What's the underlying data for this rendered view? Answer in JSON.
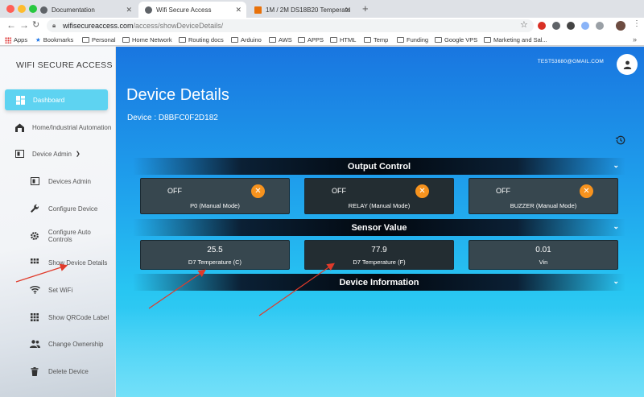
{
  "browser": {
    "tabs": [
      {
        "title": "Documentation",
        "favicon_color": "#5f6368"
      },
      {
        "title": "Wifi Secure Access",
        "favicon_color": "#5f6368"
      },
      {
        "title": "1M / 2M DS18B20 Temperatu",
        "favicon_color": "#e8710a"
      }
    ],
    "new_tab": "+",
    "url_host": "wifisecureaccess.com",
    "url_path": "/access/showDeviceDetails/",
    "bookmarks": [
      "Apps",
      "Bookmarks",
      "Personal",
      "Home Network",
      "Routing docs",
      "Arduino",
      "AWS",
      "APPS",
      "HTML",
      "Temp",
      "Funding",
      "Google VPS",
      "Marketing and Sal..."
    ]
  },
  "sidebar": {
    "brand": "WIFI SECURE ACCESS",
    "items": [
      {
        "label": "Dashboard",
        "icon": "dashboard-icon"
      },
      {
        "label": "Home/Industrial Automation",
        "icon": "home-icon"
      },
      {
        "label": "Device Admin",
        "icon": "device-admin-icon"
      },
      {
        "label": "Devices Admin",
        "icon": "devices-admin-icon"
      },
      {
        "label": "Configure Device",
        "icon": "wrench-icon"
      },
      {
        "label": "Configure Auto Controls",
        "icon": "gear-icon"
      },
      {
        "label": "Show Device Details",
        "icon": "grid-icon"
      },
      {
        "label": "Set WiFi",
        "icon": "wifi-icon"
      },
      {
        "label": "Show QRCode Label",
        "icon": "qrcode-icon"
      },
      {
        "label": "Change Ownership",
        "icon": "people-icon"
      },
      {
        "label": "Delete Device",
        "icon": "trash-icon"
      }
    ]
  },
  "header": {
    "user_email": "TEST53680@GMAIL.COM"
  },
  "main": {
    "title": "Device Details",
    "device_id": "Device : D8BFC0F2D182",
    "output_control": {
      "title": "Output Control",
      "outputs": [
        {
          "state": "OFF",
          "label": "P0 (Manual Mode)",
          "close": "✕"
        },
        {
          "state": "OFF",
          "label": "RELAY (Manual Mode)",
          "close": "✕"
        },
        {
          "state": "OFF",
          "label": "BUZZER (Manual Mode)",
          "close": "✕"
        }
      ]
    },
    "sensor_value": {
      "title": "Sensor Value",
      "sensors": [
        {
          "value": "25.5",
          "label": "D7 Temperature (C)"
        },
        {
          "value": "77.9",
          "label": "D7 Temperature (F)"
        },
        {
          "value": "0.01",
          "label": "Vin"
        }
      ]
    },
    "device_information": {
      "title": "Device Information"
    }
  },
  "colors": {
    "accent": "#5ed3f1",
    "close_button": "#f7931e",
    "annotation_arrow": "#e03a2a"
  }
}
